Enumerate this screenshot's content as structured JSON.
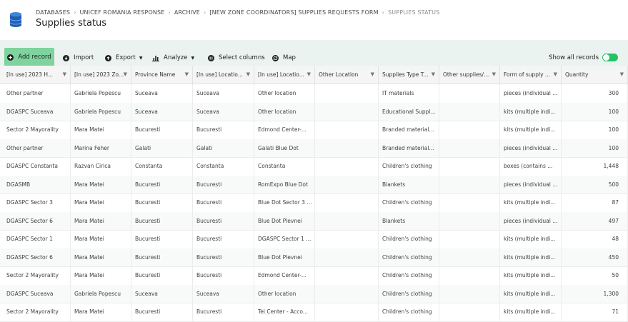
{
  "header": {
    "breadcrumb": [
      "DATABASES",
      "UNICEF ROMANIA RESPONSE",
      "ARCHIVE",
      "[NEW ZONE COORDINATORS] SUPPLIES REQUESTS FORM",
      "SUPPLIES STATUS"
    ],
    "separator": "›",
    "title": "Supplies status"
  },
  "toolbar": {
    "add_record": "Add record",
    "import": "Import",
    "export": "Export",
    "analyze": "Analyze",
    "select_columns": "Select columns",
    "map": "Map",
    "show_all_records": "Show all records",
    "show_all_on": true
  },
  "columns": [
    "[In use] 2023 H...",
    "[In use] 2023 Zo...",
    "Province Name",
    "[In use] Locatio...",
    "[In use] Locatio...",
    "Other Location",
    "Supplies Type T...",
    "Other supplies/...",
    "Form of supply ...",
    "Quantity"
  ],
  "rows": [
    [
      "Other partner",
      "Gabriela Popescu",
      "Suceava",
      "Suceava",
      "Other location",
      "",
      "IT materials",
      "",
      "pieces (individual ...",
      "300"
    ],
    [
      "DGASPC Suceava",
      "Gabriela Popescu",
      "Suceava",
      "Suceava",
      "Other location",
      "",
      "Educational Suppl...",
      "",
      "kits (multiple indi...",
      "100"
    ],
    [
      "Sector 2 Mayorality",
      "Mara Matei",
      "Bucuresti",
      "Bucuresti",
      "Edmond Center-...",
      "",
      "Branded material...",
      "",
      "kits (multiple indi...",
      "100"
    ],
    [
      "Other partner",
      "Marina Feher",
      "Galati",
      "Galati",
      "Galati Blue Dot",
      "",
      "Branded material...",
      "",
      "pieces (individual ...",
      "100"
    ],
    [
      "DGASPC Constanta",
      "Razvan Cirica",
      "Constanta",
      "Constanta",
      "Constanta",
      "",
      "Children's clothing",
      "",
      "boxes (contains ...",
      "1,448"
    ],
    [
      "DGASMB",
      "Mara Matei",
      "Bucuresti",
      "Bucuresti",
      "RomExpo Blue Dot",
      "",
      "Blankets",
      "",
      "pieces (individual ...",
      "500"
    ],
    [
      "DGASPC Sector 3",
      "Mara Matei",
      "Bucuresti",
      "Bucuresti",
      "Blue Dot Sector 3 ...",
      "",
      "Children's clothing",
      "",
      "kits (multiple indi...",
      "87"
    ],
    [
      "DGASPC Sector 6",
      "Mara Matei",
      "Bucuresti",
      "Bucuresti",
      "Blue Dot Plevnei",
      "",
      "Blankets",
      "",
      "pieces (individual ...",
      "497"
    ],
    [
      "DGASPC Sector 1",
      "Mara Matei",
      "Bucuresti",
      "Bucuresti",
      "DGASPC Sector 1 ...",
      "",
      "Children's clothing",
      "",
      "kits (multiple indi...",
      "48"
    ],
    [
      "DGASPC Sector 6",
      "Mara Matei",
      "Bucuresti",
      "Bucuresti",
      "Blue Dot Plevnei",
      "",
      "Children's clothing",
      "",
      "kits (multiple indi...",
      "450"
    ],
    [
      "Sector 2 Mayorality",
      "Mara Matei",
      "Bucuresti",
      "Bucuresti",
      "Edmond Center-...",
      "",
      "Children's clothing",
      "",
      "kits (multiple indi...",
      "50"
    ],
    [
      "DGASPC Suceava",
      "Gabriela Popescu",
      "Suceava",
      "Suceava",
      "Other location",
      "",
      "Children's clothing",
      "",
      "kits (multiple indi...",
      "1,300"
    ],
    [
      "Sector 2 Mayorality",
      "Mara Matei",
      "Bucuresti",
      "Bucuresti",
      "Tei Center - Acco...",
      "",
      "Children's clothing",
      "",
      "kits (multiple indi...",
      "71"
    ]
  ],
  "colors": {
    "accent": "#7ed39e",
    "toolbar_bg": "#eaf3ef",
    "toggle_on": "#26c165"
  },
  "icons": [
    "database-icon",
    "plus-circle-icon",
    "import-icon",
    "export-icon",
    "bar-chart-icon",
    "select-columns-icon",
    "map-icon",
    "filter-icon"
  ]
}
